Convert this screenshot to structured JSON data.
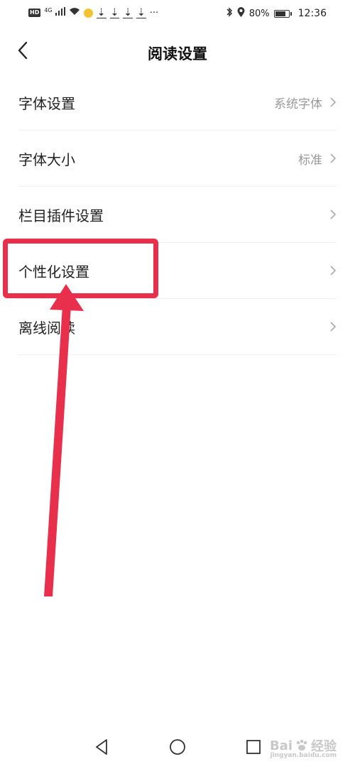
{
  "status_bar": {
    "left_badge": "HD",
    "network": "4G",
    "more": "···",
    "battery_text": "80%",
    "battery_level": 0.8,
    "time": "12:36"
  },
  "header": {
    "title": "阅读设置"
  },
  "settings": {
    "items": [
      {
        "label": "字体设置",
        "value": "系统字体"
      },
      {
        "label": "字体大小",
        "value": "标准"
      },
      {
        "label": "栏目插件设置",
        "value": ""
      },
      {
        "label": "个性化设置",
        "value": ""
      },
      {
        "label": "离线阅读",
        "value": ""
      }
    ]
  },
  "annotation": {
    "highlight_color": "#e8304d"
  },
  "watermark": {
    "brand": "Bai",
    "brand_suffix": "经验",
    "domain": "jingyan.baidu.com"
  },
  "icons": {
    "back": "chevron-left-icon",
    "row_arrow": "chevron-right-icon",
    "nav_back": "triangle-back-icon",
    "nav_home": "circle-home-icon",
    "nav_recent": "square-recent-icon"
  }
}
